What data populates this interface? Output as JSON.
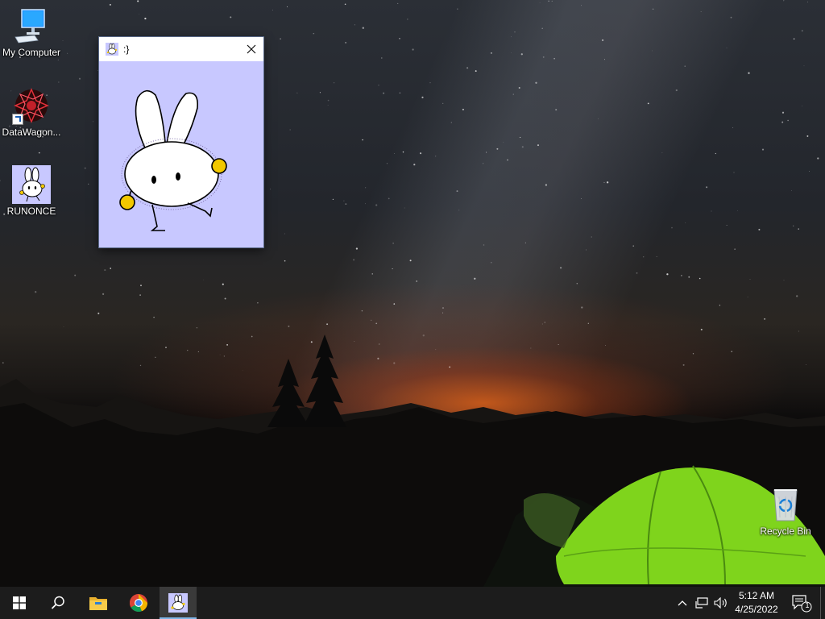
{
  "desktop": {
    "icons": [
      {
        "label": "My Computer",
        "icon": "monitor-icon"
      },
      {
        "label": "DataWagon...",
        "icon": "red-geometric-icon"
      },
      {
        "label": "RUNONCE",
        "icon": "bunny-icon"
      },
      {
        "label": "Recycle Bin",
        "icon": "recycle-bin-icon"
      }
    ]
  },
  "window": {
    "title": ":}",
    "icon": "bunny-icon",
    "background_color": "#c8c8ff"
  },
  "taskbar": {
    "start": "windows-start-icon",
    "search": "search-icon",
    "pinned": [
      "file-explorer-icon",
      "chrome-icon",
      "bunny-app-icon"
    ],
    "tray": {
      "chevron": "chevron-up-icon",
      "network": "network-icon",
      "volume": "volume-icon",
      "time": "5:12 AM",
      "date": "4/25/2022",
      "notification_count": "1"
    }
  }
}
